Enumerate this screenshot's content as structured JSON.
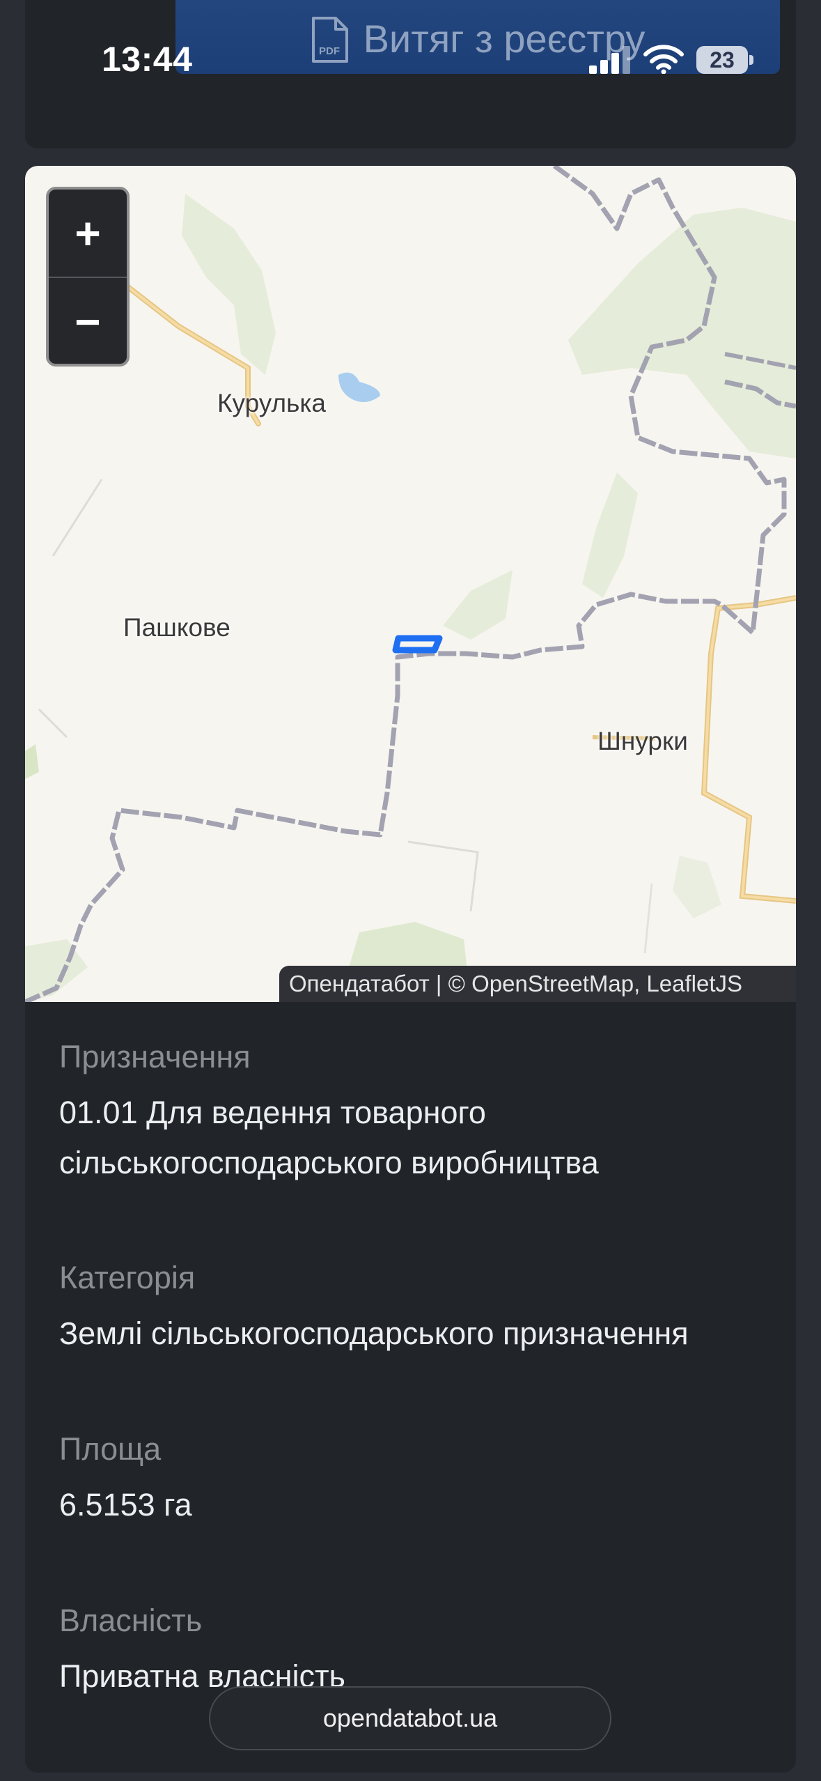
{
  "status_bar": {
    "time": "13:44",
    "battery_level": "23",
    "icons": [
      "cellular-signal-icon",
      "wifi-icon",
      "battery-icon"
    ]
  },
  "top_card": {
    "pdf_button_label": "Витяг з реєстру",
    "pdf_icon_text": "PDF"
  },
  "map": {
    "zoom_in_label": "+",
    "zoom_out_label": "−",
    "attribution": "Опендатабот | © OpenStreetMap, LeafletJS",
    "places": [
      "Курулька",
      "Пашкове",
      "Шнурки"
    ],
    "parcel_color": "#1f6ff2",
    "boundary_color": "#a3a2b1",
    "road_color": "#f2c978",
    "forest_color": "#e5ecd9",
    "water_color": "#a8cdef"
  },
  "details": {
    "purpose_label": "Призначення",
    "purpose_value": "01.01 Для ведення товарного сільськогосподарського виробництва",
    "category_label": "Категорія",
    "category_value": "Землі сільськогосподарського призначення",
    "area_label": "Площа",
    "area_value": "6.5153 га",
    "ownership_label": "Власність",
    "ownership_value": "Приватна власність"
  },
  "footer": {
    "site_label": "opendatabot.ua"
  },
  "colors": {
    "page_bg": "#2a2d33",
    "card_bg": "#212429",
    "pdf_button_bg": "#1d3f78"
  }
}
